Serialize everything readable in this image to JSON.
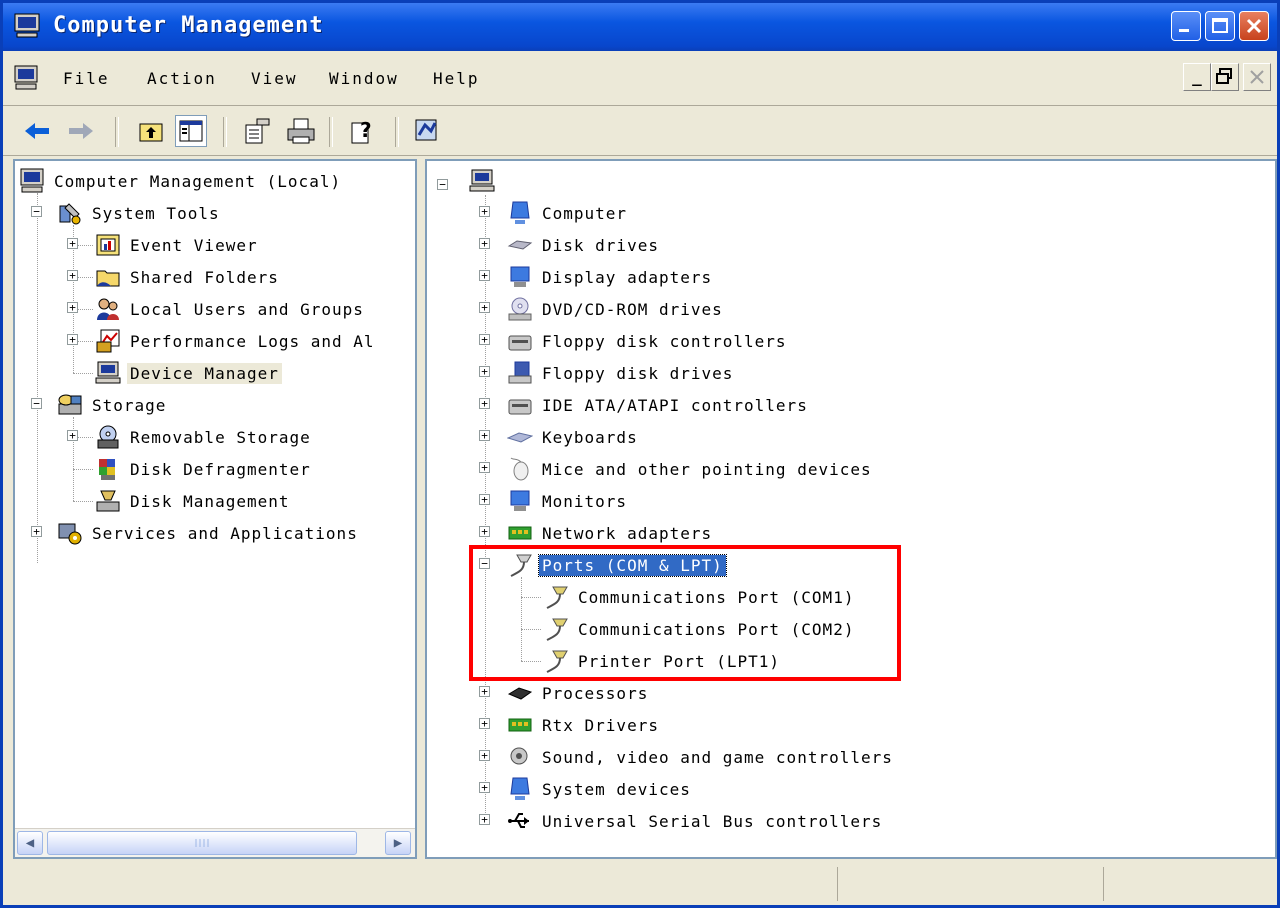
{
  "window": {
    "title": "Computer Management"
  },
  "menu": {
    "items": [
      {
        "label": "File"
      },
      {
        "label": "Action"
      },
      {
        "label": "View"
      },
      {
        "label": "Window"
      },
      {
        "label": "Help"
      }
    ]
  },
  "toolbar": {
    "buttons": [
      "back-arrow-icon",
      "forward-arrow-icon",
      "up-one-level-icon",
      "show-hide-console-tree-icon",
      "properties-icon",
      "print-icon",
      "help-icon",
      "computer-management-icon"
    ]
  },
  "tree": {
    "root": "Computer Management (Local)",
    "system_tools": "System Tools",
    "event_viewer": "Event Viewer",
    "shared_folders": "Shared Folders",
    "local_users": "Local Users and Groups",
    "performance_logs": "Performance Logs and Al",
    "device_manager": "Device Manager",
    "storage": "Storage",
    "removable_storage": "Removable Storage",
    "disk_defragmenter": "Disk Defragmenter",
    "disk_management": "Disk Management",
    "services": "Services and Applications"
  },
  "devices": {
    "categories": [
      "Computer",
      "Disk drives",
      "Display adapters",
      "DVD/CD-ROM drives",
      "Floppy disk controllers",
      "Floppy disk drives",
      "IDE ATA/ATAPI controllers",
      "Keyboards",
      "Mice and other pointing devices",
      "Monitors",
      "Network adapters",
      "Ports (COM & LPT)",
      "Processors",
      "Rtx Drivers",
      "Sound, video and game controllers",
      "System devices",
      "Universal Serial Bus controllers"
    ],
    "ports_children": [
      "Communications Port (COM1)",
      "Communications Port (COM2)",
      "Printer Port (LPT1)"
    ]
  },
  "colors": {
    "titlebar": "#0a56e0",
    "selection": "#316ac5",
    "highlight_box": "#ff0000"
  }
}
